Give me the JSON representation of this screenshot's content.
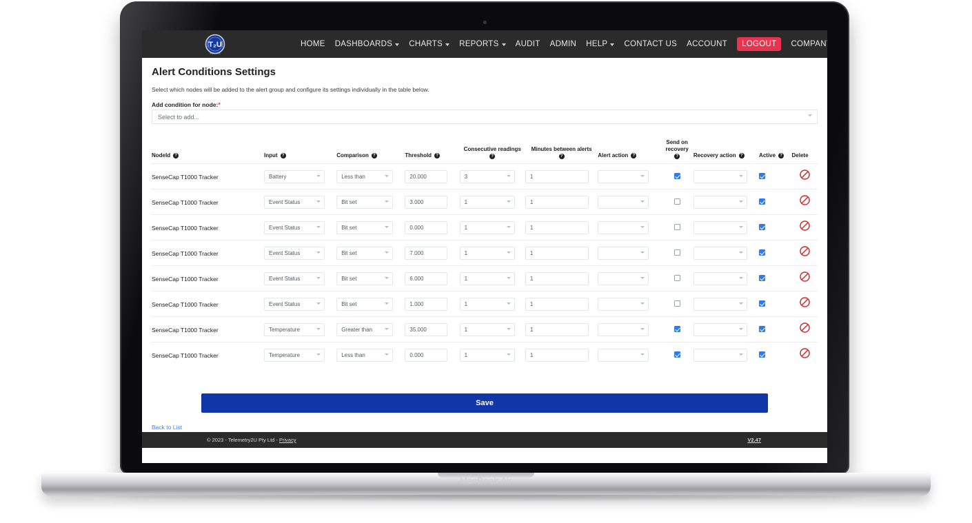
{
  "device": {
    "model_label": "MacBook Air"
  },
  "navbar": {
    "logo_text": "T2U",
    "logo_sub": "TELEMETRY2U",
    "items": [
      {
        "label": "HOME",
        "has_caret": false,
        "badge": false
      },
      {
        "label": "DASHBOARDS",
        "has_caret": true,
        "badge": false
      },
      {
        "label": "CHARTS",
        "has_caret": true,
        "badge": false
      },
      {
        "label": "REPORTS",
        "has_caret": true,
        "badge": false
      },
      {
        "label": "AUDIT",
        "has_caret": false,
        "badge": false
      },
      {
        "label": "ADMIN",
        "has_caret": false,
        "badge": false
      },
      {
        "label": "HELP",
        "has_caret": true,
        "badge": false
      },
      {
        "label": "CONTACT US",
        "has_caret": false,
        "badge": false
      },
      {
        "label": "ACCOUNT",
        "has_caret": false,
        "badge": false
      },
      {
        "label": "LOGOUT",
        "has_caret": false,
        "badge": true
      },
      {
        "label": "COMPANY",
        "has_caret": true,
        "badge": false
      }
    ],
    "badge_color": "#e8344e",
    "background": "#2b2b2b"
  },
  "page": {
    "title": "Alert Conditions Settings",
    "subtitle": "Select which nodes will be added to the alert group and configure its settings individually in the table below.",
    "add_condition_label": "Add condition for node:",
    "required_marker": "*",
    "add_condition_placeholder": "Select to add...",
    "save_label": "Save",
    "back_label": "Back to List"
  },
  "table": {
    "headers": [
      {
        "label": "NodeId",
        "help": true,
        "align": "left",
        "stacked": false
      },
      {
        "label": "Input",
        "help": true,
        "align": "left",
        "stacked": false
      },
      {
        "label": "Comparison",
        "help": true,
        "align": "left",
        "stacked": false
      },
      {
        "label": "Threshold",
        "help": true,
        "align": "left",
        "stacked": false
      },
      {
        "label": "Consecutive readings",
        "help": true,
        "align": "center",
        "stacked": true
      },
      {
        "label": "Minutes between alerts",
        "help": true,
        "align": "center",
        "stacked": true
      },
      {
        "label": "Alert action",
        "help": true,
        "align": "left",
        "stacked": false
      },
      {
        "label": "Send on recovery",
        "help": true,
        "align": "center",
        "stacked": true
      },
      {
        "label": "Recovery action",
        "help": true,
        "align": "left",
        "stacked": false
      },
      {
        "label": "Active",
        "help": true,
        "align": "left",
        "stacked": false
      },
      {
        "label": "Delete",
        "help": false,
        "align": "left",
        "stacked": false
      }
    ],
    "help_glyph": "?",
    "rows": [
      {
        "node_id": "SenseCap T1000 Tracker",
        "input": "Battery",
        "comparison": "Less than",
        "threshold": "20.000",
        "consecutive": "3",
        "minutes": "1",
        "alert_action": "",
        "send_on_recovery": true,
        "recovery_action": "",
        "active": true
      },
      {
        "node_id": "SenseCap T1000 Tracker",
        "input": "Event Status",
        "comparison": "Bit set",
        "threshold": "3.000",
        "consecutive": "1",
        "minutes": "1",
        "alert_action": "",
        "send_on_recovery": false,
        "recovery_action": "",
        "active": true
      },
      {
        "node_id": "SenseCap T1000 Tracker",
        "input": "Event Status",
        "comparison": "Bit set",
        "threshold": "0.000",
        "consecutive": "1",
        "minutes": "1",
        "alert_action": "",
        "send_on_recovery": false,
        "recovery_action": "",
        "active": true
      },
      {
        "node_id": "SenseCap T1000 Tracker",
        "input": "Event Status",
        "comparison": "Bit set",
        "threshold": "7.000",
        "consecutive": "1",
        "minutes": "1",
        "alert_action": "",
        "send_on_recovery": false,
        "recovery_action": "",
        "active": true
      },
      {
        "node_id": "SenseCap T1000 Tracker",
        "input": "Event Status",
        "comparison": "Bit set",
        "threshold": "6.000",
        "consecutive": "1",
        "minutes": "1",
        "alert_action": "",
        "send_on_recovery": false,
        "recovery_action": "",
        "active": true
      },
      {
        "node_id": "SenseCap T1000 Tracker",
        "input": "Event Status",
        "comparison": "Bit set",
        "threshold": "1.000",
        "consecutive": "1",
        "minutes": "1",
        "alert_action": "",
        "send_on_recovery": false,
        "recovery_action": "",
        "active": true
      },
      {
        "node_id": "SenseCap T1000 Tracker",
        "input": "Temperature",
        "comparison": "Greater than",
        "threshold": "35.000",
        "consecutive": "1",
        "minutes": "1",
        "alert_action": "",
        "send_on_recovery": true,
        "recovery_action": "",
        "active": true
      },
      {
        "node_id": "SenseCap T1000 Tracker",
        "input": "Temperature",
        "comparison": "Less than",
        "threshold": "0.000",
        "consecutive": "1",
        "minutes": "1",
        "alert_action": "",
        "send_on_recovery": true,
        "recovery_action": "",
        "active": true
      }
    ],
    "delete_icon": "ban-icon"
  },
  "footer": {
    "copyright": "© 2023 - Telemetry2U Pty Ltd - ",
    "privacy_label": "Privacy",
    "version": "V2.47"
  },
  "colors": {
    "primary_button": "#1036a8",
    "checkbox_on": "#2b7bf3",
    "delete_red": "#d62728",
    "link_blue": "#4a83d6"
  }
}
